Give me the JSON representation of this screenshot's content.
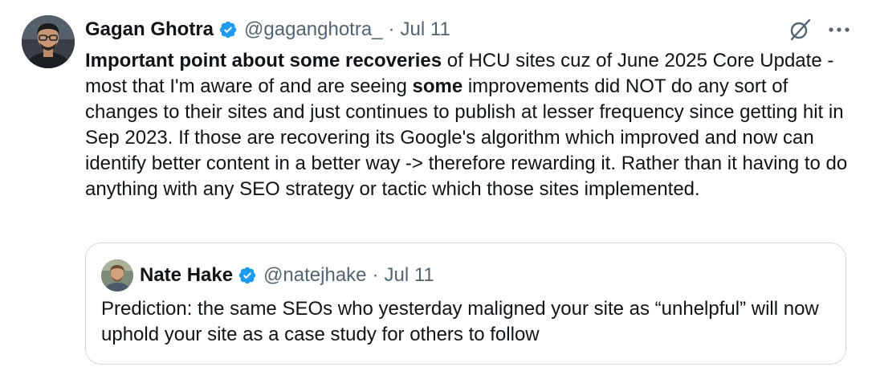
{
  "tweet": {
    "author": {
      "name": "Gagan Ghotra",
      "handle": "@gaganghotra_",
      "separator": "·",
      "date": "Jul 11",
      "avatar": "profile-photo"
    },
    "icons": {
      "verified": "verified-badge-icon",
      "grok": "grok-icon",
      "more": "more-options-icon"
    },
    "colors": {
      "verified": "#1d9bf0",
      "text": "#0f1419",
      "muted": "#536471",
      "border": "#cfd9de"
    },
    "text": {
      "bold_lead": "Important point about some recoveries",
      "part1": " of HCU sites cuz of June 2025 Core Update - most that I'm aware of and are seeing ",
      "bold_some": "some",
      "part2": " improvements did NOT do any sort of changes to their sites and just continues to publish at lesser frequency since getting hit in Sep 2023. If those are recovering its Google's algorithm which improved and now can identify better content in a better way -> therefore rewarding it. Rather than it having to do anything with any SEO strategy or tactic which those sites implemented."
    },
    "quoted": {
      "name": "Nate Hake",
      "handle": "@natejhake",
      "separator": "·",
      "date": "Jul 11",
      "text": "Prediction: the same SEOs who yesterday maligned your site as “unhelpful” will now uphold your site as a case study for others to follow"
    }
  }
}
